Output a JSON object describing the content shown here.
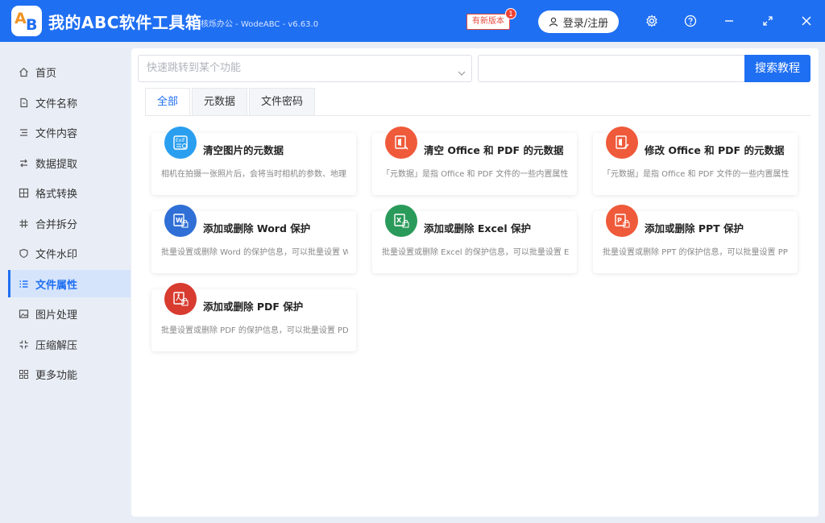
{
  "app": {
    "title": "我的ABC软件工具箱",
    "subtitle": "核烁办公 - WodeABC - v6.63.0",
    "new_version": "有新版本",
    "badge_count": "1",
    "login": "登录/注册",
    "logo_letters": "AB"
  },
  "sidebar": {
    "items": [
      {
        "label": "首页",
        "icon": "home-icon"
      },
      {
        "label": "文件名称",
        "icon": "file-name-icon"
      },
      {
        "label": "文件内容",
        "icon": "file-content-icon"
      },
      {
        "label": "数据提取",
        "icon": "data-extract-icon"
      },
      {
        "label": "格式转换",
        "icon": "format-convert-icon"
      },
      {
        "label": "合并拆分",
        "icon": "merge-split-icon"
      },
      {
        "label": "文件水印",
        "icon": "watermark-icon"
      },
      {
        "label": "文件属性",
        "icon": "file-attr-icon"
      },
      {
        "label": "图片处理",
        "icon": "image-icon"
      },
      {
        "label": "压缩解压",
        "icon": "compress-icon"
      },
      {
        "label": "更多功能",
        "icon": "more-icon"
      }
    ],
    "active_index": 7
  },
  "toolbar": {
    "quick_jump_placeholder": "快速跳转到某个功能",
    "search_placeholder": "",
    "search_button": "搜索教程"
  },
  "tabs": [
    {
      "label": "全部",
      "active": true
    },
    {
      "label": "元数据",
      "active": false
    },
    {
      "label": "文件密码",
      "active": false
    }
  ],
  "cards": [
    {
      "title": "清空图片的元数据",
      "desc": "相机在拍摄一张照片后，会将当时相机的参数、地理",
      "icon": "exif-icon",
      "color": "#2a9ff0"
    },
    {
      "title": "清空 Office 和 PDF 的元数据",
      "desc": "「元数据」是指 Office 和 PDF 文件的一些内置属性",
      "icon": "office-clear-icon",
      "color": "#ef5a3a"
    },
    {
      "title": "修改 Office 和 PDF 的元数据",
      "desc": "「元数据」是指 Office 和 PDF 文件的一些内置属性",
      "icon": "office-edit-icon",
      "color": "#ef5a3a"
    },
    {
      "title": "添加或删除 Word 保护",
      "desc": "批量设置或删除 Word 的保护信息，可以批量设置 W",
      "icon": "word-lock-icon",
      "color": "#2f6fd6"
    },
    {
      "title": "添加或删除 Excel 保护",
      "desc": "批量设置或删除 Excel 的保护信息，可以批量设置 E",
      "icon": "excel-lock-icon",
      "color": "#2a9a5a"
    },
    {
      "title": "添加或删除 PPT 保护",
      "desc": "批量设置或删除 PPT 的保护信息，可以批量设置 PP",
      "icon": "ppt-lock-icon",
      "color": "#ef5a3a"
    },
    {
      "title": "添加或删除 PDF 保护",
      "desc": "批量设置或删除 PDF 的保护信息，可以批量设置 PD",
      "icon": "pdf-lock-icon",
      "color": "#d83b2f"
    }
  ],
  "colors": {
    "accent": "#1f6ff2",
    "sidebar_bg": "#e9eef6",
    "active_bg": "#d6e4fb"
  }
}
